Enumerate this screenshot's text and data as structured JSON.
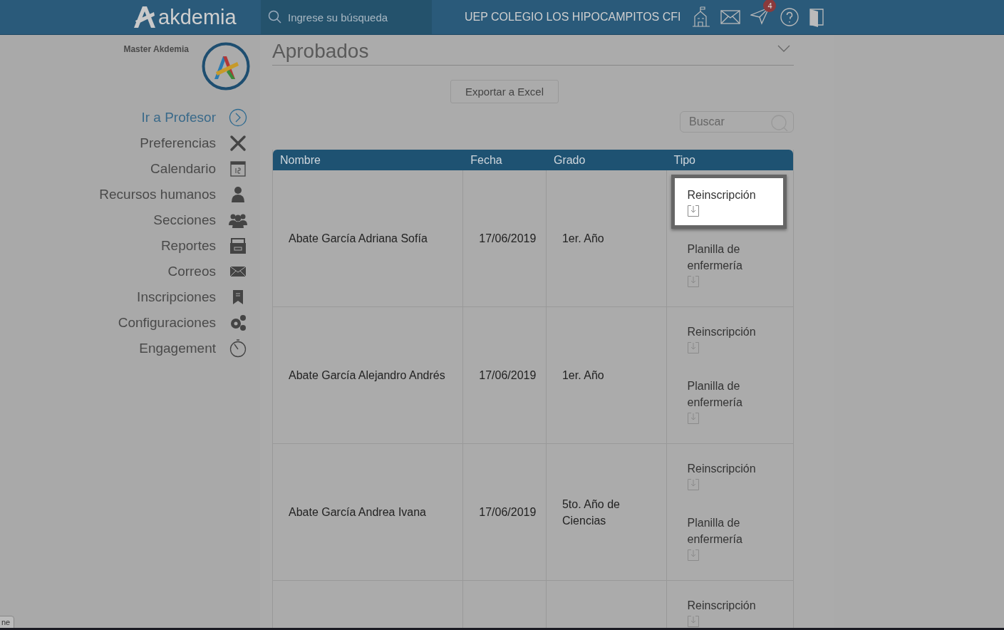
{
  "header": {
    "logo": "akdemia",
    "search": {
      "placeholder": "Ingrese su búsqueda"
    },
    "school": "UEP COLEGIO LOS HIPOCAMPITOS CFI",
    "notifications_badge": "4"
  },
  "sidebar": {
    "user": "Master Akdemia",
    "items": [
      {
        "label": "Ir a Profesor",
        "selected": true
      },
      {
        "label": "Preferencias",
        "selected": false
      },
      {
        "label": "Calendario",
        "selected": false
      },
      {
        "label": "Recursos humanos",
        "selected": false
      },
      {
        "label": "Secciones",
        "selected": false
      },
      {
        "label": "Reportes",
        "selected": false
      },
      {
        "label": "Correos",
        "selected": false
      },
      {
        "label": "Inscripciones",
        "selected": false
      },
      {
        "label": "Configuraciones",
        "selected": false
      },
      {
        "label": "Engagement",
        "selected": false
      }
    ]
  },
  "main": {
    "title": "Aprobados",
    "export_button": "Exportar a Excel",
    "search": {
      "placeholder": "Buscar"
    },
    "table": {
      "columns": [
        "Nombre",
        "Fecha",
        "Grado",
        "Tipo"
      ],
      "rows": [
        {
          "name": "Abate García Adriana Sofía",
          "date": "17/06/2019",
          "grade": "1er. Año",
          "documents": [
            {
              "label": "Reinscripción",
              "highlighted": true
            },
            {
              "label": "Planilla de enfermería",
              "highlighted": false
            }
          ]
        },
        {
          "name": "Abate García Alejandro Andrés",
          "date": "17/06/2019",
          "grade": "1er. Año",
          "documents": [
            {
              "label": "Reinscripción",
              "highlighted": false
            },
            {
              "label": "Planilla de enfermería",
              "highlighted": false
            }
          ]
        },
        {
          "name": "Abate García Andrea Ivana",
          "date": "17/06/2019",
          "grade": "5to. Año de Ciencias",
          "documents": [
            {
              "label": "Reinscripción",
              "highlighted": false
            },
            {
              "label": "Planilla de enfermería",
              "highlighted": false
            }
          ]
        },
        {
          "documents": [
            {
              "label": "Reinscripción",
              "highlighted": false
            }
          ]
        }
      ]
    }
  },
  "corner_tab": "ne"
}
